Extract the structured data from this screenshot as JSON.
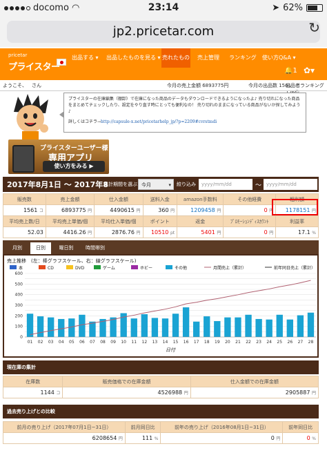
{
  "statusbar": {
    "carrier": "docomo",
    "time": "23:14",
    "battery": "62%"
  },
  "url": "jp2.pricetar.com",
  "nav": {
    "logo_small": "pricetar",
    "logo": "プライスター",
    "menus": [
      "出品する ▾",
      "出品したものを見る ▾",
      "売れたもの",
      "売上管理",
      "ランキング",
      "使い方Q&A ▾"
    ],
    "notification_count": "1"
  },
  "infobar": {
    "greeting": "ようこそ、",
    "user": "さん",
    "monthly_sales_label": "今月の売上金額 6893775円",
    "monthly_count_label": "今月の出品数 1561",
    "ranking_label": "出品者ランキング 126位"
  },
  "notice": {
    "text": "プライスターの在庫編集（棚卸）で在庫になった商品のデータもダウンロードできるようになったよ♪ 売り切れになった商品をまとめてチェックしたり、設定をやり直す時にとっても便利なの！ 売り切れのままになっている商品がないか探してみよう♪",
    "link_prefix": "詳しくはコチラ→",
    "link": "http://capsule-x.net/pricetarhelp_jp/?p=2209#cvrstmdi"
  },
  "app_banner": {
    "line1": "プライスターユーザー様",
    "line2": "専用アプリ",
    "button": "使い方をみる ▶"
  },
  "period": {
    "date_from": "2017年8月1日",
    "tilde": "～",
    "date_to": "2017年8",
    "range_label": "集計期間を選ぶ",
    "range_value": "今月",
    "filter_label": "絞り込み",
    "date_placeholder": "yyyy/mm/dd"
  },
  "stats_row1": {
    "headers": [
      "販売数",
      "売上金額",
      "仕入金額",
      "送料入金",
      "amazon手数料",
      "その他経費",
      "粗利額"
    ],
    "values": [
      "1561",
      "6893775",
      "4490615",
      "360",
      "1209458",
      "0",
      "1178151"
    ],
    "units": [
      "コ",
      "円",
      "円",
      "円",
      "円",
      "円",
      "円"
    ]
  },
  "stats_row2": {
    "headers": [
      "平均売上数/日",
      "平均売上単価/個",
      "平均仕入単価/個",
      "ポイント",
      "返金",
      "ﾌﾟﾛﾓｰｼｮﾝﾃﾞｨｽｶｳﾝﾄ",
      "利益率"
    ],
    "values": [
      "52.03",
      "4416.26",
      "2876.76",
      "10510",
      "5401",
      "0",
      "17.1"
    ],
    "units": [
      "",
      "円",
      "円",
      "pt",
      "円",
      "円",
      "%"
    ]
  },
  "tabs": [
    "月別",
    "日別",
    "曜日別",
    "時間帯別"
  ],
  "chart_data": {
    "type": "bar",
    "title": "売上推移　(左：棒グラフスケール、右：線グラフスケール)",
    "xlabel": "日付",
    "legend": [
      "本",
      "CD",
      "DVD",
      "ゲーム",
      "ホビー",
      "その他",
      "月間売上（累計）",
      "前年同日売上（累計）"
    ],
    "legend_colors": [
      "#2e63c9",
      "#e34a1d",
      "#f6c21f",
      "#1f9b3a",
      "#9b2aa3",
      "#1aa3d3",
      "#b06070",
      "#333333"
    ],
    "categories": [
      "01",
      "02",
      "03",
      "04",
      "05",
      "06",
      "07",
      "08",
      "09",
      "10",
      "11",
      "12",
      "13",
      "14",
      "15",
      "16",
      "17",
      "18",
      "19",
      "20",
      "21",
      "22",
      "23",
      "24",
      "25",
      "26",
      "27",
      "28"
    ],
    "series": [
      {
        "name": "その他",
        "values": [
          220,
          195,
          185,
          170,
          175,
          210,
          145,
          170,
          185,
          225,
          175,
          215,
          180,
          175,
          220,
          280,
          145,
          195,
          150,
          185,
          185,
          210,
          170,
          165,
          210,
          165,
          205,
          230
        ]
      }
    ],
    "ylim": [
      0,
      600
    ],
    "yticks": [
      "0",
      "50",
      "100",
      "150",
      "200",
      "250",
      "300",
      "350",
      "400",
      "450",
      "500",
      "550",
      "600"
    ],
    "grid": true
  },
  "inventory": {
    "title": "現在庫の集計",
    "headers": [
      "在庫数",
      "販売価格での在庫金額",
      "仕入金額での在庫金額"
    ],
    "values": [
      "1144",
      "4526988",
      "2905887"
    ],
    "units": [
      "コ",
      "円",
      "円"
    ]
  },
  "comparison": {
    "title": "過去売り上げとの比較",
    "headers": [
      "前月の売り上げ（2017年07月1日~31日）",
      "前月同日比",
      "前年の売り上げ（2016年08月1日~31日）",
      "前年同日比"
    ],
    "values": [
      "6208654",
      "111",
      "0",
      "0"
    ],
    "units": [
      "円",
      "%",
      "円",
      "%"
    ]
  }
}
